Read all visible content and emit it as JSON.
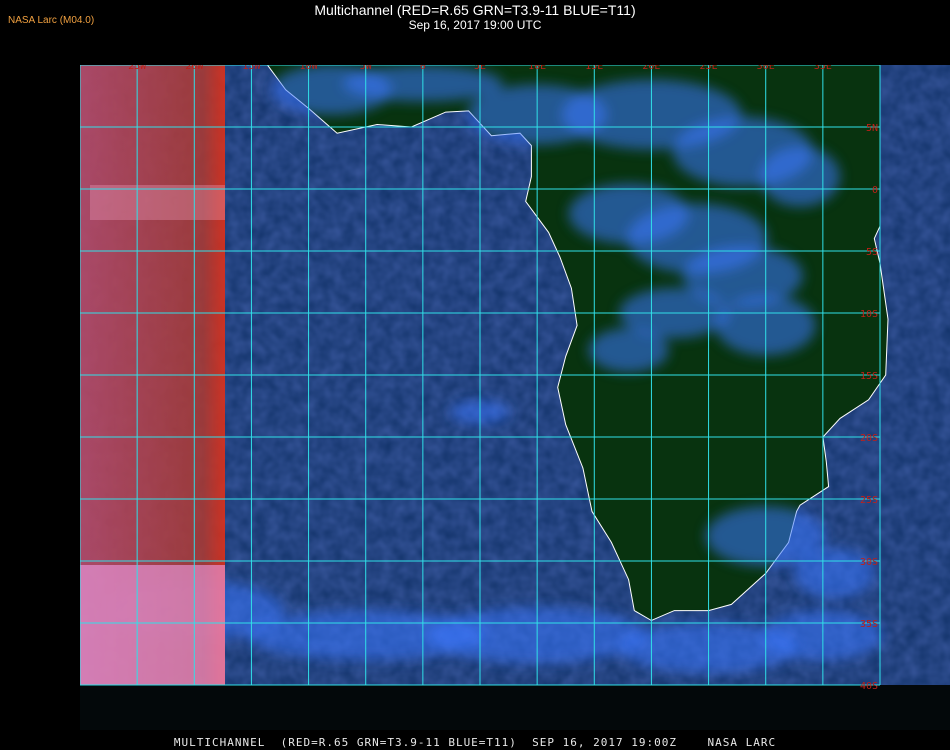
{
  "header": {
    "brand": "NASA Larc (M04.0)",
    "title": "Multichannel (RED=R.65 GRN=T3.9-11 BLUE=T11)",
    "subtitle": "Sep 16, 2017 19:00 UTC"
  },
  "footer": {
    "caption": "MULTICHANNEL  (RED=R.65 GRN=T3.9-11 BLUE=T11)  SEP 16, 2017 19:00Z    NASA LARC"
  },
  "map": {
    "projection": "lat-lon",
    "lon_range": [
      -30,
      40
    ],
    "lat_range": [
      -40,
      10
    ],
    "gridline_color": "#30e0e8",
    "grid_label_color": "#c02018",
    "coastline_color": "#ffffff",
    "lon_labels": [
      "25W",
      "20W",
      "15W",
      "10W",
      "5W",
      "0",
      "5E",
      "10E",
      "15E",
      "20E",
      "25E",
      "30E",
      "35E"
    ],
    "lat_labels": [
      "5N",
      "0",
      "5S",
      "10S",
      "15S",
      "20S",
      "25S",
      "30S",
      "35S",
      "40S"
    ],
    "colors": {
      "ocean": "#10305a",
      "land": "#07300f",
      "cloud": "#3a78ff",
      "dayside": "#c04050"
    }
  }
}
